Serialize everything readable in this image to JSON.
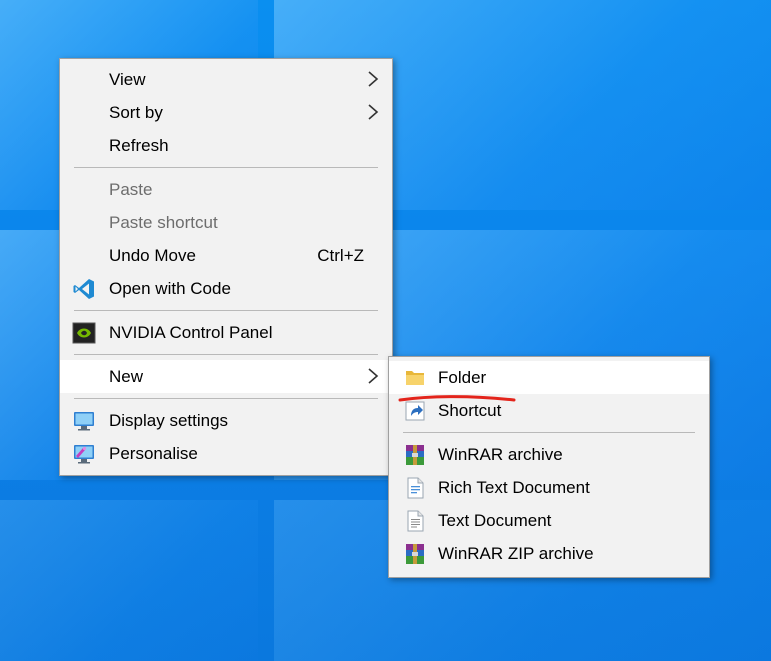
{
  "context_menu": {
    "items": [
      {
        "label": "View",
        "has_submenu": true
      },
      {
        "label": "Sort by",
        "has_submenu": true
      },
      {
        "label": "Refresh"
      },
      {
        "label": "Paste",
        "disabled": true
      },
      {
        "label": "Paste shortcut",
        "disabled": true
      },
      {
        "label": "Undo Move",
        "shortcut": "Ctrl+Z"
      },
      {
        "label": "Open with Code",
        "icon": "vscode-icon"
      },
      {
        "label": "NVIDIA Control Panel",
        "icon": "nvidia-icon"
      },
      {
        "label": "New",
        "has_submenu": true,
        "highlighted": true
      },
      {
        "label": "Display settings",
        "icon": "display-icon"
      },
      {
        "label": "Personalise",
        "icon": "personalise-icon"
      }
    ]
  },
  "new_submenu": {
    "items": [
      {
        "label": "Folder",
        "icon": "folder-icon",
        "highlighted": true
      },
      {
        "label": "Shortcut",
        "icon": "shortcut-icon"
      },
      {
        "label": "WinRAR archive",
        "icon": "winrar-icon"
      },
      {
        "label": "Rich Text Document",
        "icon": "rich-text-icon"
      },
      {
        "label": "Text Document",
        "icon": "text-document-icon"
      },
      {
        "label": "WinRAR ZIP archive",
        "icon": "winrar-zip-icon"
      }
    ]
  },
  "colors": {
    "desktop": "#0b86ec",
    "menu_bg": "#f2f2f2",
    "highlight": "#ffffff",
    "annotation": "#e3241b"
  }
}
